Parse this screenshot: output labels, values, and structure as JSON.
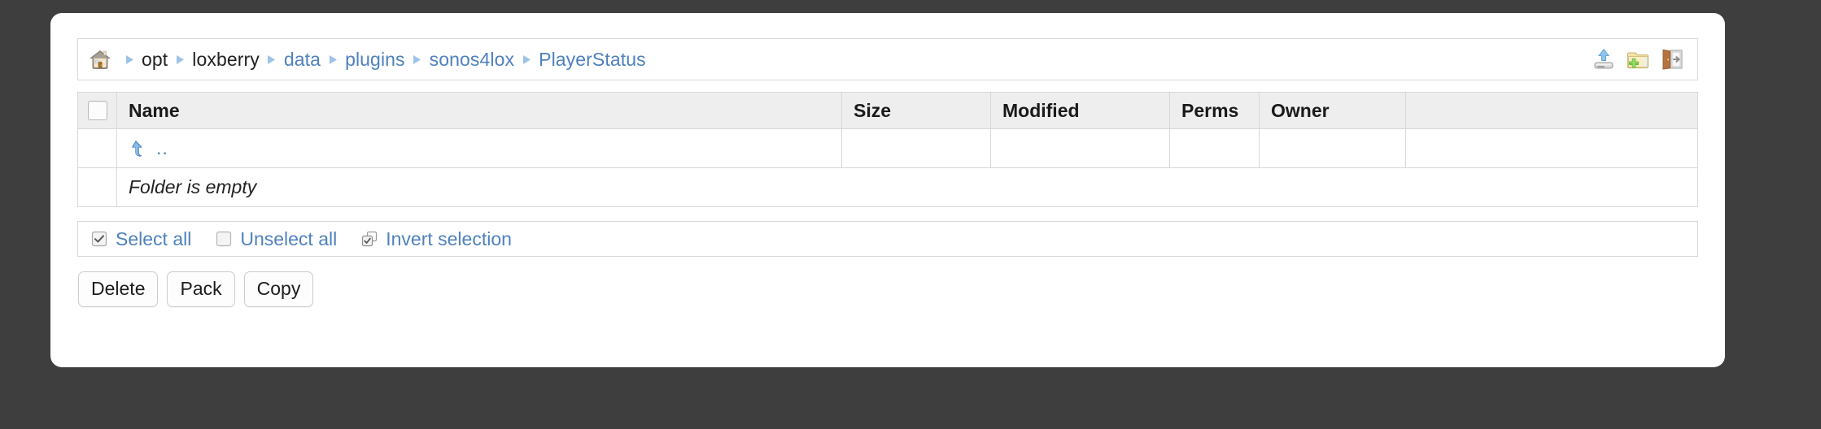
{
  "window": {
    "background_color": "#3e3e3e",
    "panel_color": "#ffffff"
  },
  "theme": {
    "link_color": "#4f81bd",
    "text_color": "#222222",
    "header_bg": "#eeeeee",
    "border_color": "#d8d8d8"
  },
  "breadcrumb": {
    "home_icon": "home-icon",
    "separator_icon": "triangle-right-icon",
    "items": [
      {
        "label": "opt",
        "style": "dark"
      },
      {
        "label": "loxberry",
        "style": "dark"
      },
      {
        "label": "data",
        "style": "link"
      },
      {
        "label": "plugins",
        "style": "link"
      },
      {
        "label": "sonos4lox",
        "style": "link"
      },
      {
        "label": "PlayerStatus",
        "style": "link"
      }
    ],
    "actions": [
      {
        "name": "upload-icon",
        "title": "Upload"
      },
      {
        "name": "new-folder-icon",
        "title": "New folder"
      },
      {
        "name": "logout-icon",
        "title": "Logout"
      }
    ]
  },
  "table": {
    "select_all_checkbox": false,
    "columns": [
      "Name",
      "Size",
      "Modified",
      "Perms",
      "Owner",
      ""
    ],
    "parent_row": {
      "icon": "arrow-up-left-icon",
      "label": "..",
      "size": "",
      "modified": "",
      "perms": "",
      "owner": "",
      "extra": ""
    },
    "empty_row": {
      "message": "Folder is empty"
    }
  },
  "selection_bar": {
    "items": [
      {
        "label": "Select all",
        "icon": "checkbox-checked-icon"
      },
      {
        "label": "Unselect all",
        "icon": "checkbox-empty-icon"
      },
      {
        "label": "Invert selection",
        "icon": "invert-selection-icon"
      }
    ]
  },
  "buttons": [
    {
      "label": "Delete"
    },
    {
      "label": "Pack"
    },
    {
      "label": "Copy"
    }
  ]
}
